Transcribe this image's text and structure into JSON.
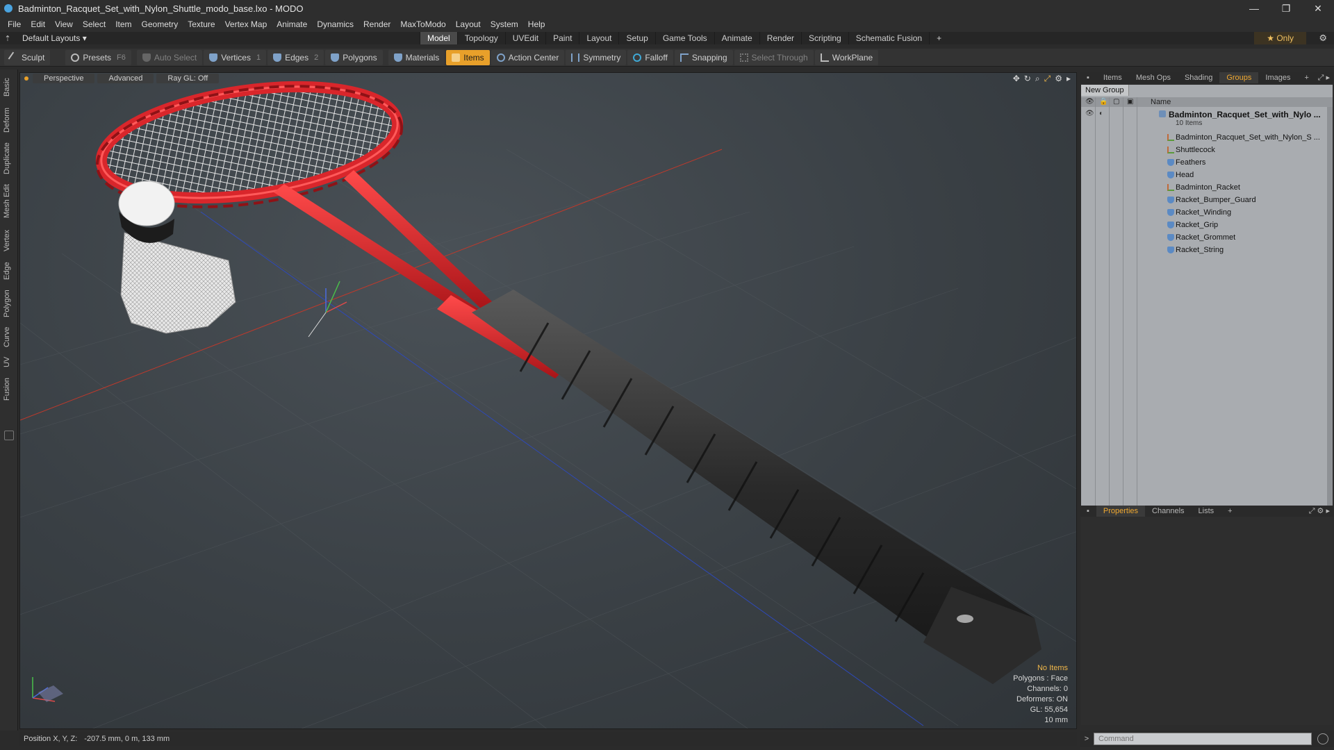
{
  "window": {
    "title": "Badminton_Racquet_Set_with_Nylon_Shuttle_modo_base.lxo - MODO",
    "controls": [
      "—",
      "❐",
      "✕"
    ]
  },
  "menu": [
    "File",
    "Edit",
    "View",
    "Select",
    "Item",
    "Geometry",
    "Texture",
    "Vertex Map",
    "Animate",
    "Dynamics",
    "Render",
    "MaxToModo",
    "Layout",
    "System",
    "Help"
  ],
  "layoutbar": {
    "layouts_label": "Default Layouts ▾",
    "tabs": [
      "Model",
      "Topology",
      "UVEdit",
      "Paint",
      "Layout",
      "Setup",
      "Game Tools",
      "Animate",
      "Render",
      "Scripting",
      "Schematic Fusion",
      "+"
    ],
    "active_tab": "Model",
    "only_label": "★  Only"
  },
  "toolbar": {
    "sculpt": "Sculpt",
    "presets": "Presets",
    "presets_key": "F6",
    "auto_select": "Auto Select",
    "vertices": "Vertices",
    "vertices_count": "1",
    "edges": "Edges",
    "edges_count": "2",
    "polygons": "Polygons",
    "materials": "Materials",
    "items": "Items",
    "action_center": "Action Center",
    "symmetry": "Symmetry",
    "falloff": "Falloff",
    "snapping": "Snapping",
    "select_through": "Select Through",
    "workplane": "WorkPlane"
  },
  "left_tabs": [
    "Basic",
    "Deform",
    "Duplicate",
    "Mesh Edit",
    "Vertex",
    "Edge",
    "Polygon",
    "Curve",
    "UV",
    "Fusion"
  ],
  "viewport": {
    "view_mode": "Perspective",
    "shading": "Advanced",
    "raygl": "Ray GL: Off",
    "info": {
      "items": "No Items",
      "polygons": "Polygons : Face",
      "channels": "Channels: 0",
      "deformers": "Deformers: ON",
      "gl": "GL: 55,654",
      "scale": "10 mm"
    },
    "colors": {
      "frame": "#d9262b",
      "grip": "#2a2a2a",
      "shuttle_head": "#f2f2f2"
    }
  },
  "status": {
    "position_label": "Position X, Y, Z:",
    "position_value": "-207.5 mm, 0 m, 133 mm"
  },
  "right_panel": {
    "top_tabs": [
      "Items",
      "Mesh Ops",
      "Shading",
      "Groups",
      "Images",
      "+"
    ],
    "active_top_tab": "Groups",
    "new_group": "New Group",
    "name_col": "Name",
    "root": {
      "label": "Badminton_Racquet_Set_with_Nylo ...",
      "count": "10 Items"
    },
    "items": [
      {
        "label": "Badminton_Racquet_Set_with_Nylon_S ...",
        "type": "locator-icon"
      },
      {
        "label": "Shuttlecock",
        "type": "locator-icon"
      },
      {
        "label": "Feathers",
        "type": "mesh-icon"
      },
      {
        "label": "Head",
        "type": "mesh-icon"
      },
      {
        "label": "Badminton_Racket",
        "type": "locator-icon"
      },
      {
        "label": "Racket_Bumper_Guard",
        "type": "mesh-icon"
      },
      {
        "label": "Racket_Winding",
        "type": "mesh-icon"
      },
      {
        "label": "Racket_Grip",
        "type": "mesh-icon"
      },
      {
        "label": "Racket_Grommet",
        "type": "mesh-icon"
      },
      {
        "label": "Racket_String",
        "type": "mesh-icon"
      }
    ],
    "bottom_tabs": [
      "Properties",
      "Channels",
      "Lists",
      "+"
    ],
    "active_bottom_tab": "Properties",
    "command_placeholder": "Command"
  }
}
